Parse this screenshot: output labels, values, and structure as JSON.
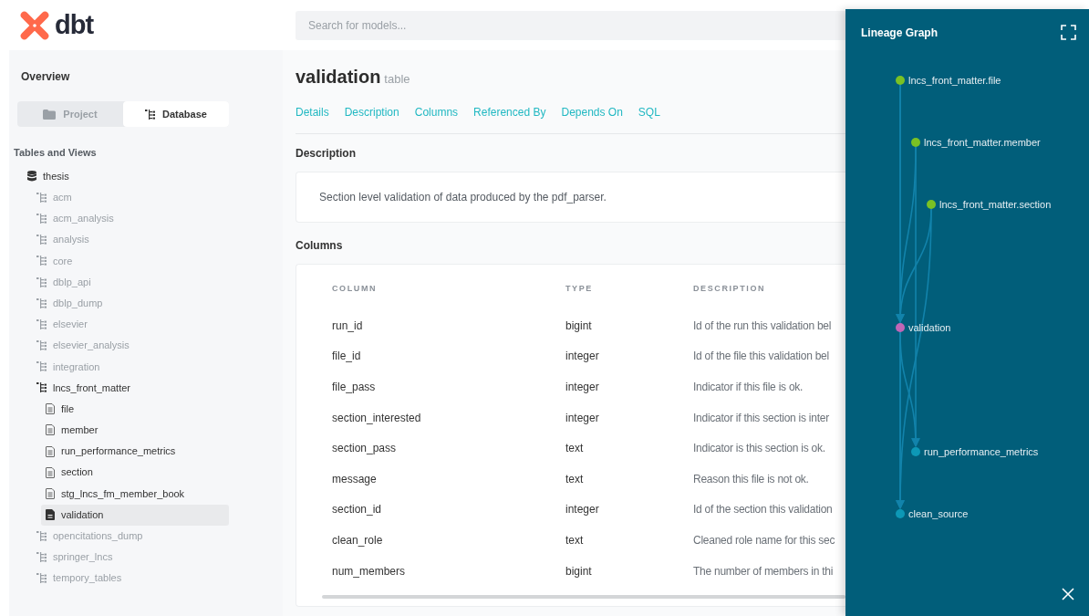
{
  "header": {
    "logo_text": "dbt",
    "search": {
      "placeholder": "Search for models..."
    }
  },
  "sidebar": {
    "title": "Overview",
    "toggle": [
      {
        "label": "Project",
        "kind": "folder",
        "selected": false
      },
      {
        "label": "Database",
        "kind": "tree",
        "selected": true
      }
    ],
    "section_title": "Tables and Views",
    "tree": [
      {
        "label": "thesis",
        "kind": "database",
        "children": [
          {
            "label": "acm",
            "kind": "schema",
            "expanded": false
          },
          {
            "label": "acm_analysis",
            "kind": "schema",
            "expanded": false
          },
          {
            "label": "analysis",
            "kind": "schema",
            "expanded": false
          },
          {
            "label": "core",
            "kind": "schema",
            "expanded": false
          },
          {
            "label": "dblp_api",
            "kind": "schema",
            "expanded": false
          },
          {
            "label": "dblp_dump",
            "kind": "schema",
            "expanded": false
          },
          {
            "label": "elsevier",
            "kind": "schema",
            "expanded": false
          },
          {
            "label": "elsevier_analysis",
            "kind": "schema",
            "expanded": false
          },
          {
            "label": "integration",
            "kind": "schema",
            "expanded": false
          },
          {
            "label": "lncs_front_matter",
            "kind": "schema",
            "expanded": true,
            "children": [
              {
                "label": "file",
                "kind": "table",
                "selected": false
              },
              {
                "label": "member",
                "kind": "table",
                "selected": false
              },
              {
                "label": "run_performance_metrics",
                "kind": "table",
                "selected": false
              },
              {
                "label": "section",
                "kind": "table",
                "selected": false
              },
              {
                "label": "stg_lncs_fm_member_book",
                "kind": "table",
                "selected": false
              },
              {
                "label": "validation",
                "kind": "table",
                "selected": true
              }
            ]
          },
          {
            "label": "opencitations_dump",
            "kind": "schema",
            "expanded": false
          },
          {
            "label": "springer_lncs",
            "kind": "schema",
            "expanded": false
          },
          {
            "label": "tempory_tables",
            "kind": "schema",
            "expanded": false
          }
        ]
      }
    ]
  },
  "model": {
    "name": "validation",
    "type": "table",
    "nav": [
      "Details",
      "Description",
      "Columns",
      "Referenced By",
      "Depends On",
      "SQL"
    ],
    "description_heading": "Description",
    "description": "Section level validation of data produced by the pdf_parser.",
    "columns_heading": "Columns",
    "columns_table": {
      "columns": [
        "COLUMN",
        "TYPE",
        "DESCRIPTION"
      ],
      "rows": [
        [
          "run_id",
          "bigint",
          "Id of the run this validation bel"
        ],
        [
          "file_id",
          "integer",
          "Id of the file this validation bel"
        ],
        [
          "file_pass",
          "integer",
          "Indicator if this file is ok."
        ],
        [
          "section_interested",
          "integer",
          "Indicator if this section is inter"
        ],
        [
          "section_pass",
          "text",
          "Indicator is this section is ok."
        ],
        [
          "message",
          "text",
          "Reason this file is not ok."
        ],
        [
          "section_id",
          "integer",
          "Id of the section this validation"
        ],
        [
          "clean_role",
          "text",
          "Cleaned role name for this sec"
        ],
        [
          "num_members",
          "bigint",
          "The number of members in thi"
        ]
      ]
    }
  },
  "lineage": {
    "title": "Lineage Graph",
    "nodes": [
      {
        "label": "lncs_front_matter.file",
        "color": "#7ac124"
      },
      {
        "label": "lncs_front_matter.member",
        "color": "#7ac124"
      },
      {
        "label": "lncs_front_matter.section",
        "color": "#7ac124"
      },
      {
        "label": "validation",
        "color": "#c066b6"
      },
      {
        "label": "run_performance_metrics",
        "color": "#0d98b6"
      },
      {
        "label": "clean_source",
        "color": "#0d98b6"
      }
    ]
  }
}
